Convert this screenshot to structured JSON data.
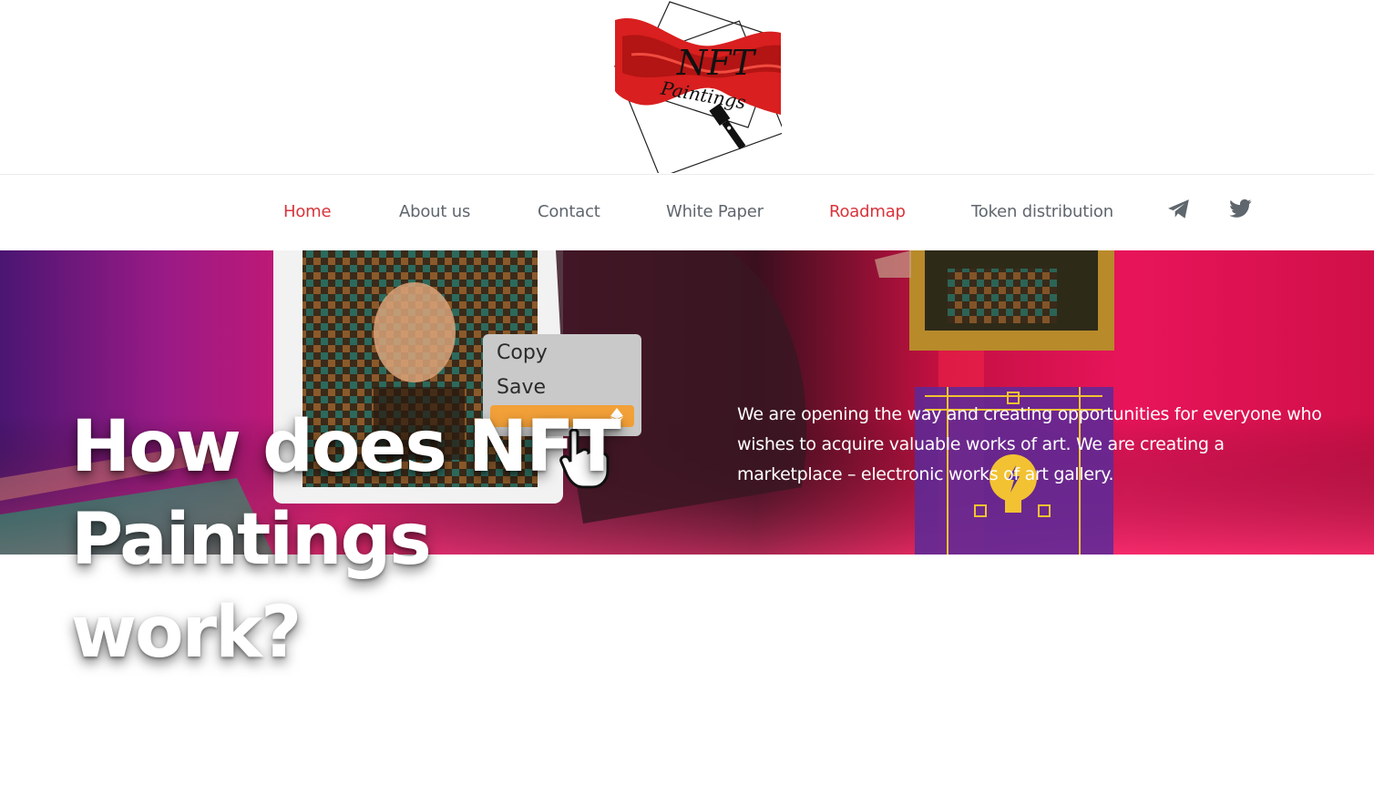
{
  "logo": {
    "text_top": "NFT",
    "text_bottom": "Paintings"
  },
  "nav": {
    "items": [
      {
        "label": "Home",
        "active": true
      },
      {
        "label": "About us",
        "active": false
      },
      {
        "label": "Contact",
        "active": false
      },
      {
        "label": "White Paper",
        "active": false
      },
      {
        "label": "Roadmap",
        "active": true
      },
      {
        "label": "Token distribution",
        "active": false
      }
    ],
    "social": [
      "telegram-icon",
      "twitter-icon"
    ]
  },
  "hero": {
    "headline": "How does NFT Paintings work?",
    "description": "We are opening the way and creating opportunities for everyone who wishes to acquire valuable works of art. We are creating a marketplace – electronic works of art gallery.",
    "context_menu": {
      "copy": "Copy",
      "save": "Save"
    }
  },
  "colors": {
    "accent": "#d8333a",
    "nav_text": "#5f666d",
    "hero_pink": "#e01a5f",
    "hero_purple": "#4a1a7a"
  }
}
